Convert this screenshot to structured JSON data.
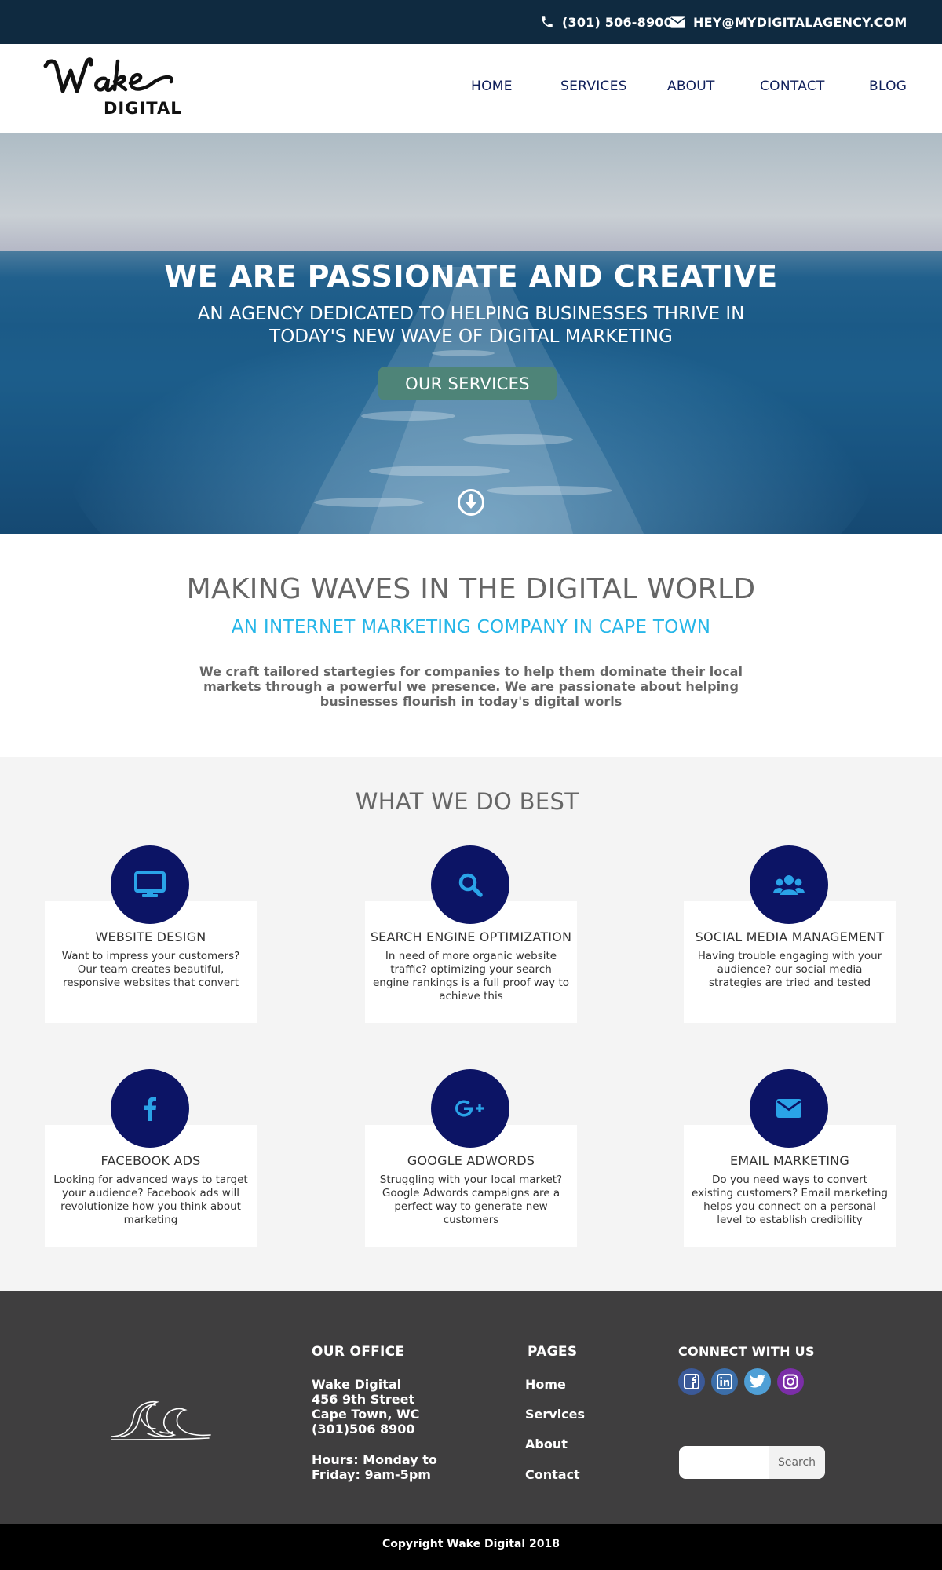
{
  "topbar": {
    "phone": "(301) 506-8900",
    "email": "HEY@MYDIGITALAGENCY.COM",
    "phone_icon": "phone-icon",
    "email_icon": "envelope-icon"
  },
  "logo": {
    "script": "Wake",
    "word": "DIGITAL"
  },
  "nav": {
    "items": [
      "HOME",
      "SERVICES",
      "ABOUT",
      "CONTACT",
      "BLOG"
    ]
  },
  "hero": {
    "title": "WE ARE PASSIONATE AND CREATIVE",
    "subtitle": "AN AGENCY DEDICATED TO HELPING BUSINESSES THRIVE IN TODAY'S NEW WAVE OF DIGITAL MARKETING",
    "button": "OUR SERVICES",
    "scroll_icon": "arrow-down-circle-icon"
  },
  "intro": {
    "heading": "MAKING WAVES IN THE DIGITAL WORLD",
    "subheading": "AN INTERNET MARKETING COMPANY IN CAPE TOWN",
    "text": "We craft tailored startegies for companies to help them dominate their local markets through a powerful we presence. We are passionate about helping businesses flourish in today's digital worls"
  },
  "services": {
    "heading": "WHAT WE DO BEST",
    "items": [
      {
        "icon": "monitor-icon",
        "title": "WEBSITE DESIGN",
        "text": "Want to impress your customers? Our team creates beautiful, responsive websites that convert"
      },
      {
        "icon": "search-icon",
        "title": "SEARCH ENGINE OPTIMIZATION",
        "text": "In need of more organic website traffic? optimizing your search engine rankings is a full proof way to achieve this"
      },
      {
        "icon": "users-icon",
        "title": "SOCIAL MEDIA MANAGEMENT",
        "text": "Having trouble engaging with your audience? our social media strategies are tried and tested"
      },
      {
        "icon": "facebook-icon",
        "title": "FACEBOOK ADS",
        "text": "Looking for advanced ways to target your audience? Facebook ads will revolutionize how you think about marketing"
      },
      {
        "icon": "google-plus-icon",
        "title": "GOOGLE ADWORDS",
        "text": "Struggling with your local market? Google Adwords campaigns are a perfect way to generate new customers"
      },
      {
        "icon": "envelope-icon",
        "title": "EMAIL MARKETING",
        "text": "Do you need ways to convert existing customers? Email marketing helps you connect on a personal level to establish credibility"
      }
    ]
  },
  "footer": {
    "office_title": "OUR OFFICE",
    "office_lines": [
      "Wake Digital",
      "456 9th Street",
      "Cape Town, WC",
      "(301)506 8900"
    ],
    "hours_lines": [
      "Hours: Monday to",
      "Friday: 9am-5pm"
    ],
    "pages_title": "PAGES",
    "pages": [
      "Home",
      "Services",
      "About",
      "Contact"
    ],
    "connect_title": "CONNECT WITH US",
    "social": [
      {
        "icon": "facebook-icon",
        "color": "#3b5998"
      },
      {
        "icon": "linkedin-icon",
        "color": "#0e76a8"
      },
      {
        "icon": "twitter-icon",
        "color": "#4f9fd6"
      },
      {
        "icon": "instagram-icon",
        "color": "#7b2ea8"
      }
    ],
    "search_button": "Search",
    "search_placeholder": ""
  },
  "copyright": "Copyright Wake Digital 2018",
  "colors": {
    "topbar": "#0f2a40",
    "nav_text": "#0f1f5a",
    "hero_button": "#4e8478",
    "accent_blue": "#26b6e8",
    "icon_circle": "#0c1465",
    "icon_glyph": "#2aa3e8",
    "footer": "#3f3e3f"
  }
}
